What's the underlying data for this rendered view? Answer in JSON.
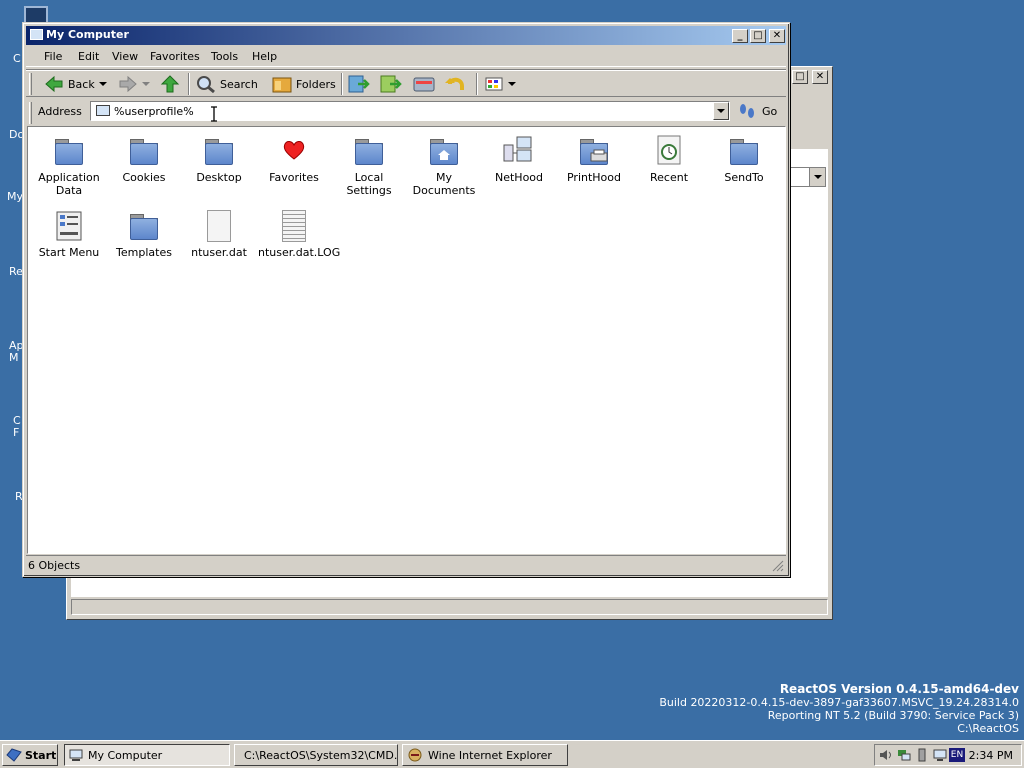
{
  "window": {
    "title": "My Computer",
    "min_label": "_",
    "max_label": "□",
    "close_label": "✕"
  },
  "menu": [
    "File",
    "Edit",
    "View",
    "Favorites",
    "Tools",
    "Help"
  ],
  "toolbar": {
    "back_label": "Back",
    "search_label": "Search",
    "folders_label": "Folders"
  },
  "address": {
    "label": "Address",
    "value": "%userprofile%",
    "go_label": "Go"
  },
  "files": [
    {
      "name": "Application Data",
      "icon": "folder-icon"
    },
    {
      "name": "Cookies",
      "icon": "folder-icon"
    },
    {
      "name": "Desktop",
      "icon": "folder-icon"
    },
    {
      "name": "Favorites",
      "icon": "heart-icon"
    },
    {
      "name": "Local Settings",
      "icon": "folder-icon"
    },
    {
      "name": "My Documents",
      "icon": "folder-home-icon"
    },
    {
      "name": "NetHood",
      "icon": "network-icon"
    },
    {
      "name": "PrintHood",
      "icon": "folder-printer-icon"
    },
    {
      "name": "Recent",
      "icon": "recent-icon"
    },
    {
      "name": "SendTo",
      "icon": "folder-icon"
    },
    {
      "name": "Start Menu",
      "icon": "start-menu-icon"
    },
    {
      "name": "Templates",
      "icon": "folder-icon"
    },
    {
      "name": "ntuser.dat",
      "icon": "document-icon"
    },
    {
      "name": "ntuser.dat.LOG",
      "icon": "text-document-icon"
    }
  ],
  "status": {
    "text": "6 Objects"
  },
  "taskbar": {
    "start_label": "Start",
    "tasks": [
      "My Computer",
      "C:\\ReactOS\\System32\\CMD...",
      "Wine Internet Explorer"
    ],
    "lang": "EN",
    "clock": "2:34 PM"
  },
  "version": {
    "line1": "ReactOS Version 0.4.15-amd64-dev",
    "line2": "Build 20220312-0.4.15-dev-3897-gaf33607.MSVC_19.24.28314.0",
    "line3": "Reporting NT 5.2 (Build 3790: Service Pack 3)",
    "line4": "C:\\ReactOS"
  },
  "desktop_stubs": [
    "C",
    "Do",
    "My",
    "Re",
    "Ap\nM",
    "C\nF",
    "R"
  ],
  "colors": {
    "desktop": "#3a6ea5",
    "titlebar_start": "#0a246a",
    "titlebar_end": "#a6caf0"
  }
}
